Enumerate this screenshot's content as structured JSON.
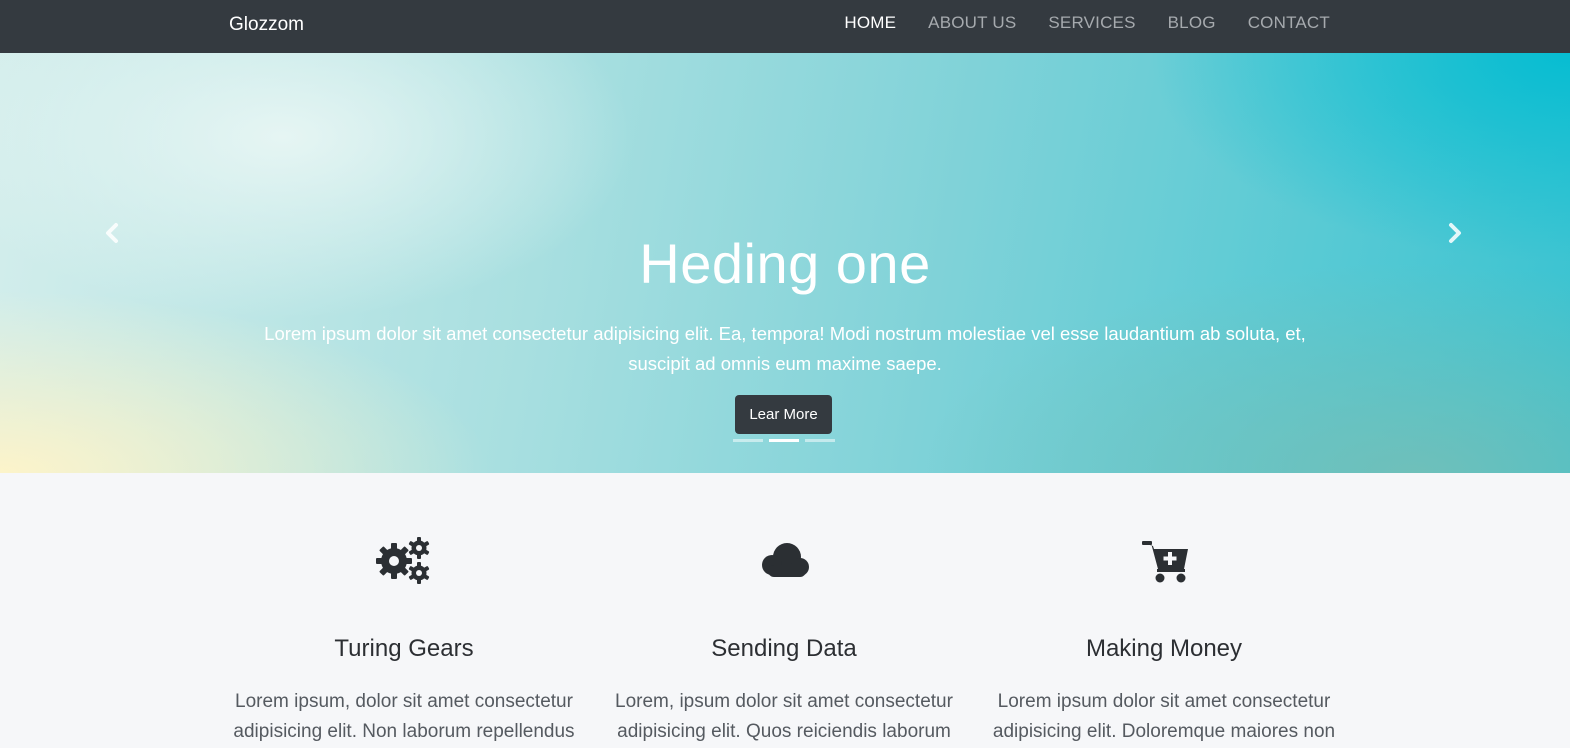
{
  "navbar": {
    "brand": "Glozzom",
    "links": [
      "HOME",
      "ABOUT US",
      "SERVICES",
      "BLOG",
      "CONTACT"
    ],
    "active_link": "HOME"
  },
  "hero": {
    "heading": "Heding one",
    "text": "Lorem ipsum dolor sit amet consectetur adipisicing elit. Ea, tempora! Modi nostrum molestiae vel esse laudantium ab soluta, et, suscipit ad omnis eum maxime saepe.",
    "button_label": "Lear More",
    "prev_icon": "chevron-left",
    "next_icon": "chevron-right",
    "slide_count": 3,
    "active_slide": 2
  },
  "features": [
    {
      "icon": "gears-icon",
      "title": "Turing Gears",
      "text": "Lorem ipsum, dolor sit amet consectetur adipisicing elit. Non laborum repellendus"
    },
    {
      "icon": "cloud-icon",
      "title": "Sending Data",
      "text": "Lorem, ipsum dolor sit amet consectetur adipisicing elit. Quos reiciendis laborum"
    },
    {
      "icon": "cart-plus-icon",
      "title": "Making Money",
      "text": "Lorem ipsum dolor sit amet consectetur adipisicing elit. Doloremque maiores non"
    }
  ],
  "colors": {
    "navbar_bg": "#343a40",
    "nav_link": "#a6aaae",
    "nav_link_active": "#ffffff",
    "button_bg": "#343a40",
    "section_bg": "#f6f7f9"
  }
}
